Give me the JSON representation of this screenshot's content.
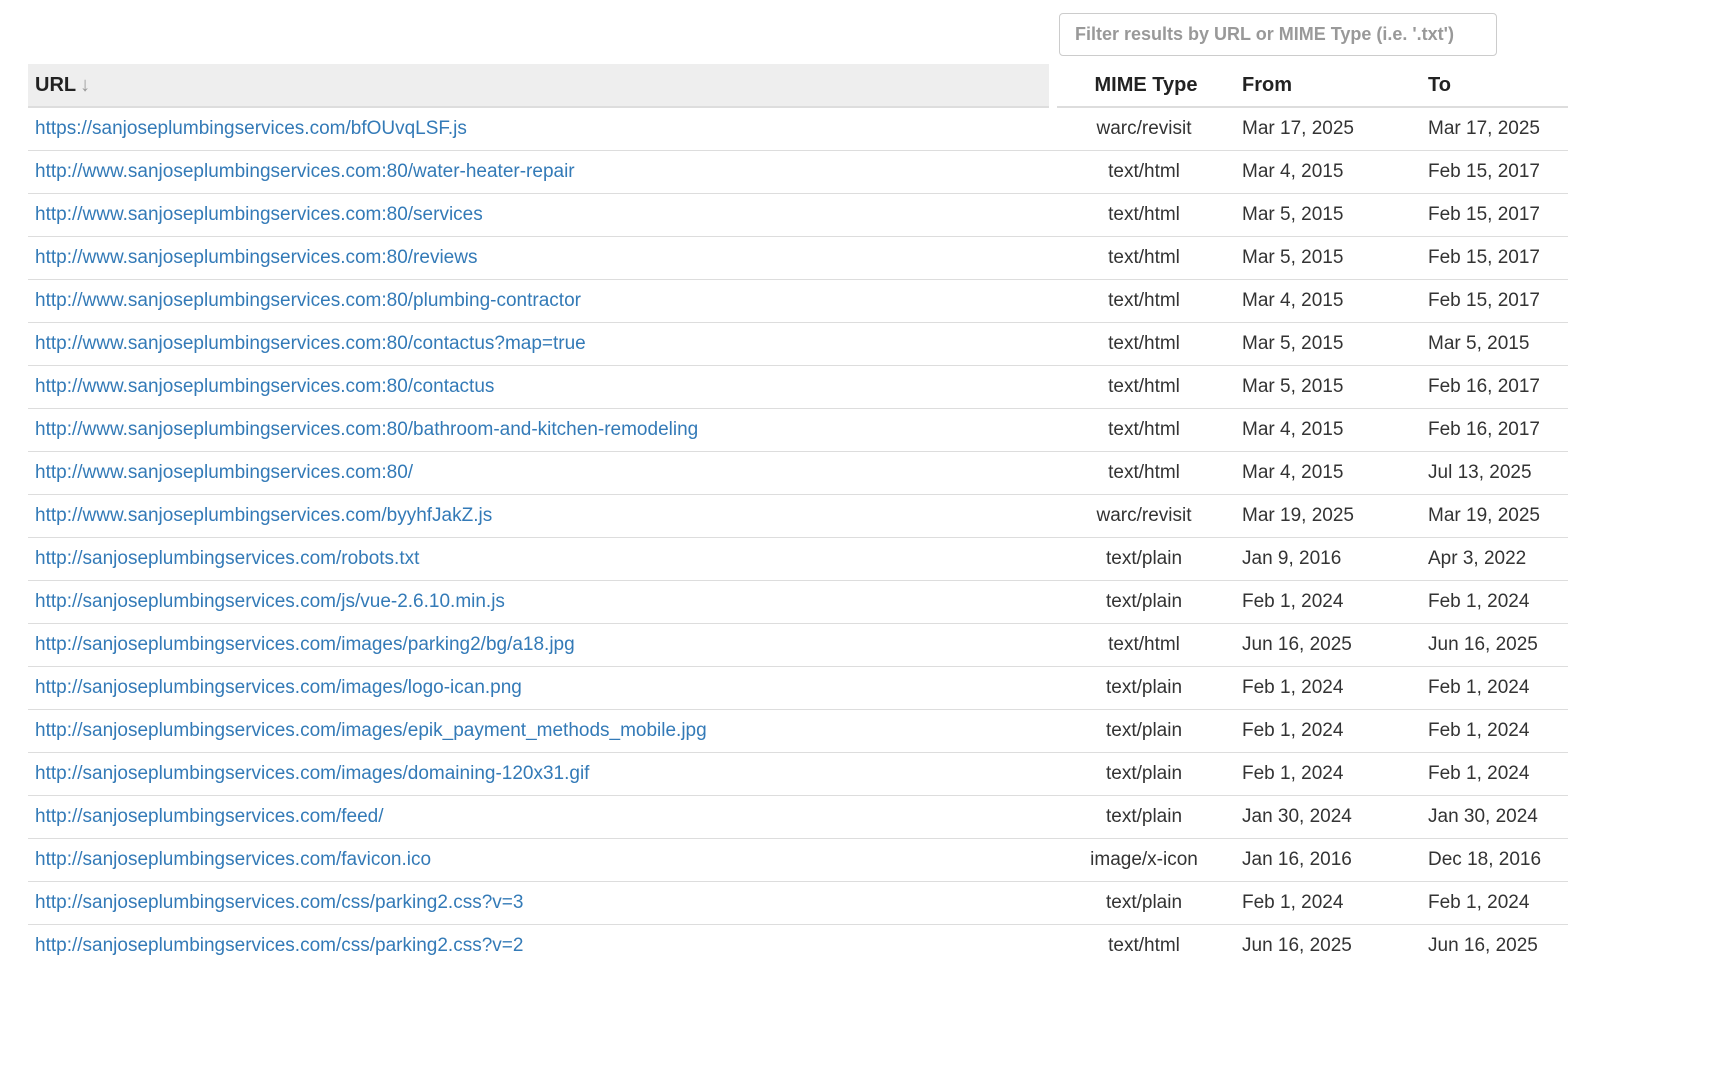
{
  "filter": {
    "placeholder": "Filter results by URL or MIME Type (i.e. '.txt')",
    "value": ""
  },
  "table": {
    "headers": {
      "url": "URL",
      "url_sort_indicator": "↓",
      "mime": "MIME Type",
      "from": "From",
      "to": "To"
    },
    "rows": [
      {
        "url": "https://sanjoseplumbingservices.com/bfOUvqLSF.js",
        "mime": "warc/revisit",
        "from": "Mar 17, 2025",
        "to": "Mar 17, 2025"
      },
      {
        "url": "http://www.sanjoseplumbingservices.com:80/water-heater-repair",
        "mime": "text/html",
        "from": "Mar 4, 2015",
        "to": "Feb 15, 2017"
      },
      {
        "url": "http://www.sanjoseplumbingservices.com:80/services",
        "mime": "text/html",
        "from": "Mar 5, 2015",
        "to": "Feb 15, 2017"
      },
      {
        "url": "http://www.sanjoseplumbingservices.com:80/reviews",
        "mime": "text/html",
        "from": "Mar 5, 2015",
        "to": "Feb 15, 2017"
      },
      {
        "url": "http://www.sanjoseplumbingservices.com:80/plumbing-contractor",
        "mime": "text/html",
        "from": "Mar 4, 2015",
        "to": "Feb 15, 2017"
      },
      {
        "url": "http://www.sanjoseplumbingservices.com:80/contactus?map=true",
        "mime": "text/html",
        "from": "Mar 5, 2015",
        "to": "Mar 5, 2015"
      },
      {
        "url": "http://www.sanjoseplumbingservices.com:80/contactus",
        "mime": "text/html",
        "from": "Mar 5, 2015",
        "to": "Feb 16, 2017"
      },
      {
        "url": "http://www.sanjoseplumbingservices.com:80/bathroom-and-kitchen-remodeling",
        "mime": "text/html",
        "from": "Mar 4, 2015",
        "to": "Feb 16, 2017"
      },
      {
        "url": "http://www.sanjoseplumbingservices.com:80/",
        "mime": "text/html",
        "from": "Mar 4, 2015",
        "to": "Jul 13, 2025"
      },
      {
        "url": "http://www.sanjoseplumbingservices.com/byyhfJakZ.js",
        "mime": "warc/revisit",
        "from": "Mar 19, 2025",
        "to": "Mar 19, 2025"
      },
      {
        "url": "http://sanjoseplumbingservices.com/robots.txt",
        "mime": "text/plain",
        "from": "Jan 9, 2016",
        "to": "Apr 3, 2022"
      },
      {
        "url": "http://sanjoseplumbingservices.com/js/vue-2.6.10.min.js",
        "mime": "text/plain",
        "from": "Feb 1, 2024",
        "to": "Feb 1, 2024"
      },
      {
        "url": "http://sanjoseplumbingservices.com/images/parking2/bg/a18.jpg",
        "mime": "text/html",
        "from": "Jun 16, 2025",
        "to": "Jun 16, 2025"
      },
      {
        "url": "http://sanjoseplumbingservices.com/images/logo-ican.png",
        "mime": "text/plain",
        "from": "Feb 1, 2024",
        "to": "Feb 1, 2024"
      },
      {
        "url": "http://sanjoseplumbingservices.com/images/epik_payment_methods_mobile.jpg",
        "mime": "text/plain",
        "from": "Feb 1, 2024",
        "to": "Feb 1, 2024"
      },
      {
        "url": "http://sanjoseplumbingservices.com/images/domaining-120x31.gif",
        "mime": "text/plain",
        "from": "Feb 1, 2024",
        "to": "Feb 1, 2024"
      },
      {
        "url": "http://sanjoseplumbingservices.com/feed/",
        "mime": "text/plain",
        "from": "Jan 30, 2024",
        "to": "Jan 30, 2024"
      },
      {
        "url": "http://sanjoseplumbingservices.com/favicon.ico",
        "mime": "image/x-icon",
        "from": "Jan 16, 2016",
        "to": "Dec 18, 2016"
      },
      {
        "url": "http://sanjoseplumbingservices.com/css/parking2.css?v=3",
        "mime": "text/plain",
        "from": "Feb 1, 2024",
        "to": "Feb 1, 2024"
      },
      {
        "url": "http://sanjoseplumbingservices.com/css/parking2.css?v=2",
        "mime": "text/html",
        "from": "Jun 16, 2025",
        "to": "Jun 16, 2025"
      }
    ]
  }
}
